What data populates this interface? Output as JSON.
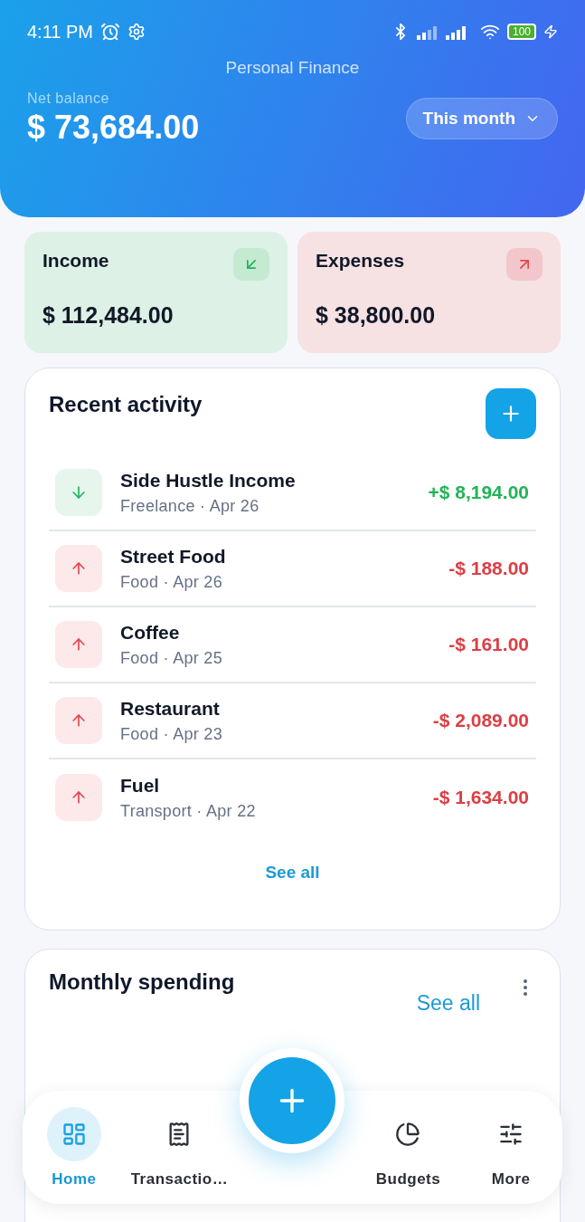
{
  "status_bar": {
    "time": "4:11 PM",
    "battery": "100"
  },
  "header": {
    "title": "Personal Finance",
    "balance_label": "Net balance",
    "balance": "$ 73,684.00",
    "period": "This month"
  },
  "summary": [
    {
      "kind": "income",
      "label": "Income",
      "amount": "$ 112,484.00"
    },
    {
      "kind": "expense",
      "label": "Expenses",
      "amount": "$ 38,800.00"
    }
  ],
  "recent_activity": {
    "title": "Recent activity",
    "see_all": "See all",
    "items": [
      {
        "kind": "income",
        "name": "Side Hustle Income",
        "meta": "Freelance · Apr 26",
        "amount": "+$ 8,194.00"
      },
      {
        "kind": "expense",
        "name": "Street Food",
        "meta": "Food · Apr 26",
        "amount": "-$ 188.00"
      },
      {
        "kind": "expense",
        "name": "Coffee",
        "meta": "Food · Apr 25",
        "amount": "-$ 161.00"
      },
      {
        "kind": "expense",
        "name": "Restaurant",
        "meta": "Food · Apr 23",
        "amount": "-$ 2,089.00"
      },
      {
        "kind": "expense",
        "name": "Fuel",
        "meta": "Transport · Apr 22",
        "amount": "-$ 1,634.00"
      }
    ]
  },
  "monthly_spending": {
    "title": "Monthly spending",
    "see_all": "See all"
  },
  "bottom_nav": [
    {
      "kind": "home",
      "label": "Home",
      "selected": true
    },
    {
      "kind": "transactions",
      "label": "Transactio…",
      "selected": false
    },
    {
      "kind": "budgets",
      "label": "Budgets",
      "selected": false
    },
    {
      "kind": "more",
      "label": "More",
      "selected": false
    }
  ]
}
